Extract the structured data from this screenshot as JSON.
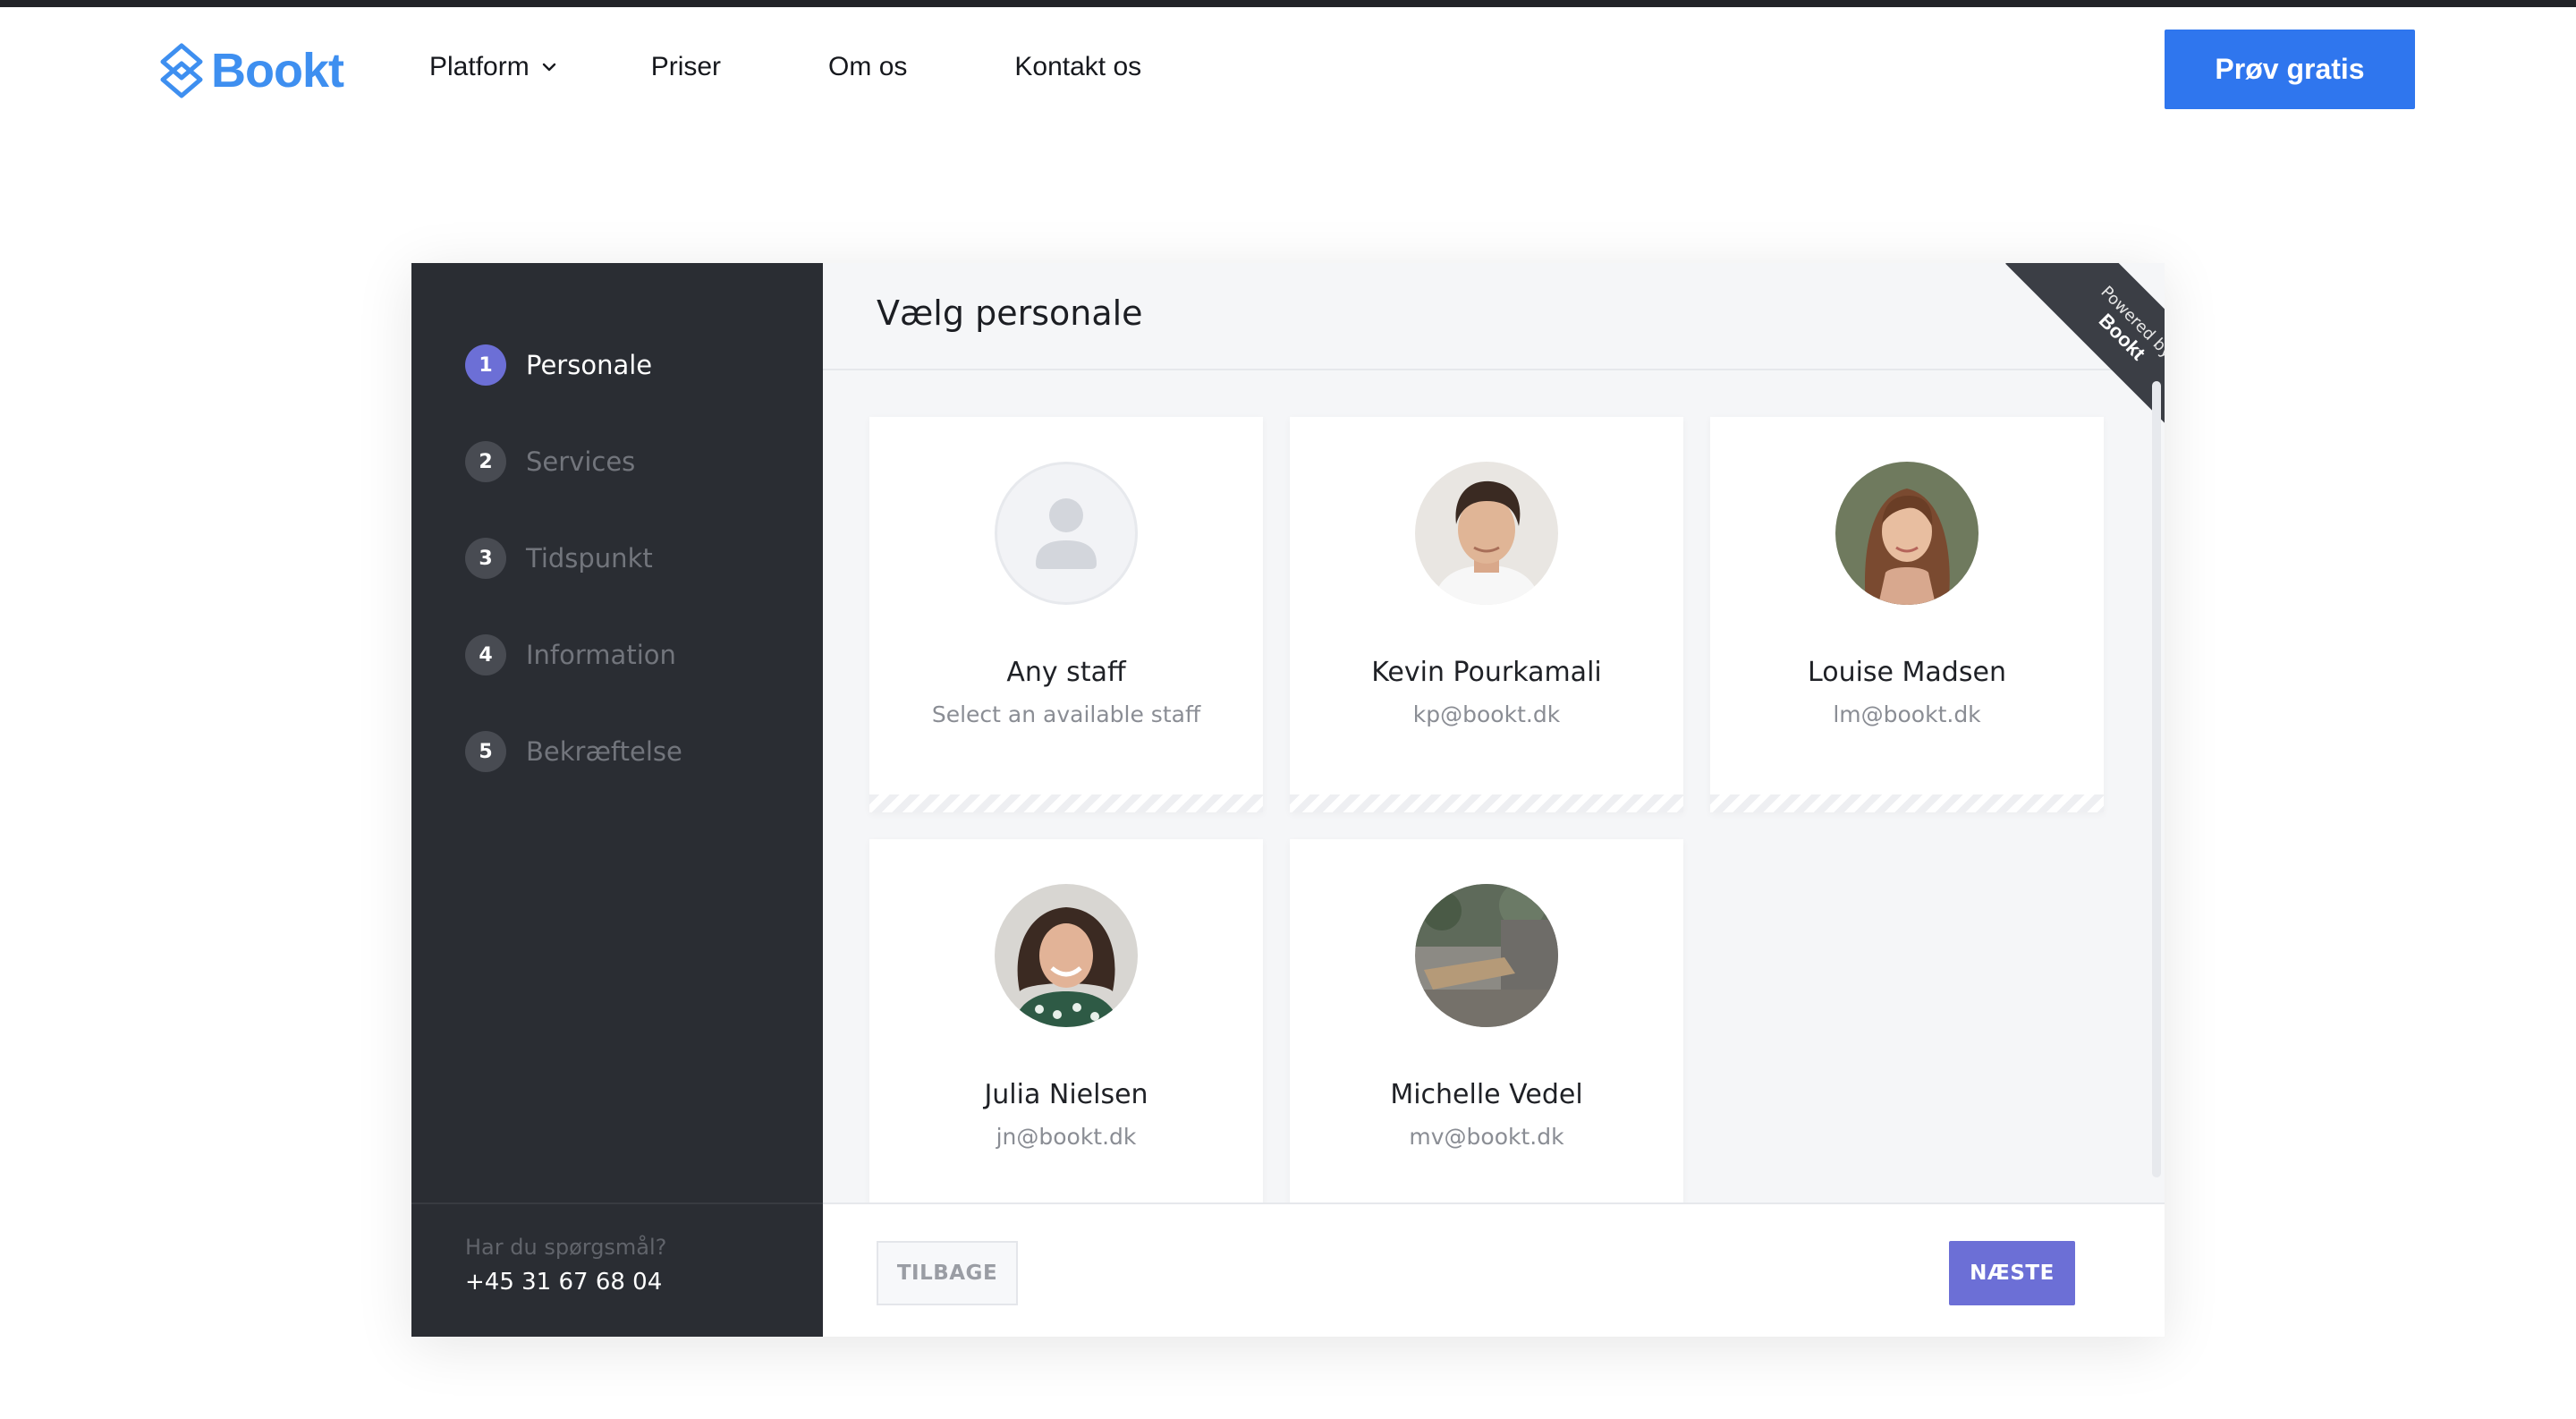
{
  "header": {
    "brand": "Bookt",
    "nav": [
      {
        "label": "Platform",
        "has_dropdown": true
      },
      {
        "label": "Priser"
      },
      {
        "label": "Om os"
      },
      {
        "label": "Kontakt os"
      }
    ],
    "cta_label": "Prøv gratis"
  },
  "sidebar": {
    "steps": [
      {
        "num": "1",
        "label": "Personale",
        "active": true
      },
      {
        "num": "2",
        "label": "Services",
        "active": false
      },
      {
        "num": "3",
        "label": "Tidspunkt",
        "active": false
      },
      {
        "num": "4",
        "label": "Information",
        "active": false
      },
      {
        "num": "5",
        "label": "Bekræftelse",
        "active": false
      }
    ],
    "help_question": "Har du spørgsmål?",
    "help_phone": "+45 31 67 68 04"
  },
  "main": {
    "title": "Vælg personale",
    "ribbon_small": "Powered by",
    "ribbon_brand": "Bookt",
    "staff": [
      {
        "name": "Any staff",
        "sub": "Select an available staff",
        "avatar": "placeholder-user-icon"
      },
      {
        "name": "Kevin Pourkamali",
        "sub": "kp@bookt.dk",
        "avatar": "photo"
      },
      {
        "name": "Louise Madsen",
        "sub": "lm@bookt.dk",
        "avatar": "photo"
      },
      {
        "name": "Julia Nielsen",
        "sub": "jn@bookt.dk",
        "avatar": "photo"
      },
      {
        "name": "Michelle Vedel",
        "sub": "mv@bookt.dk",
        "avatar": "photo"
      }
    ],
    "back_label": "TILBAGE",
    "next_label": "NÆSTE"
  },
  "colors": {
    "brand_blue": "#2f76ee",
    "logo_blue": "#3e8ff0",
    "accent_purple": "#6c6fd6",
    "sidebar_bg": "#2a2d33"
  }
}
